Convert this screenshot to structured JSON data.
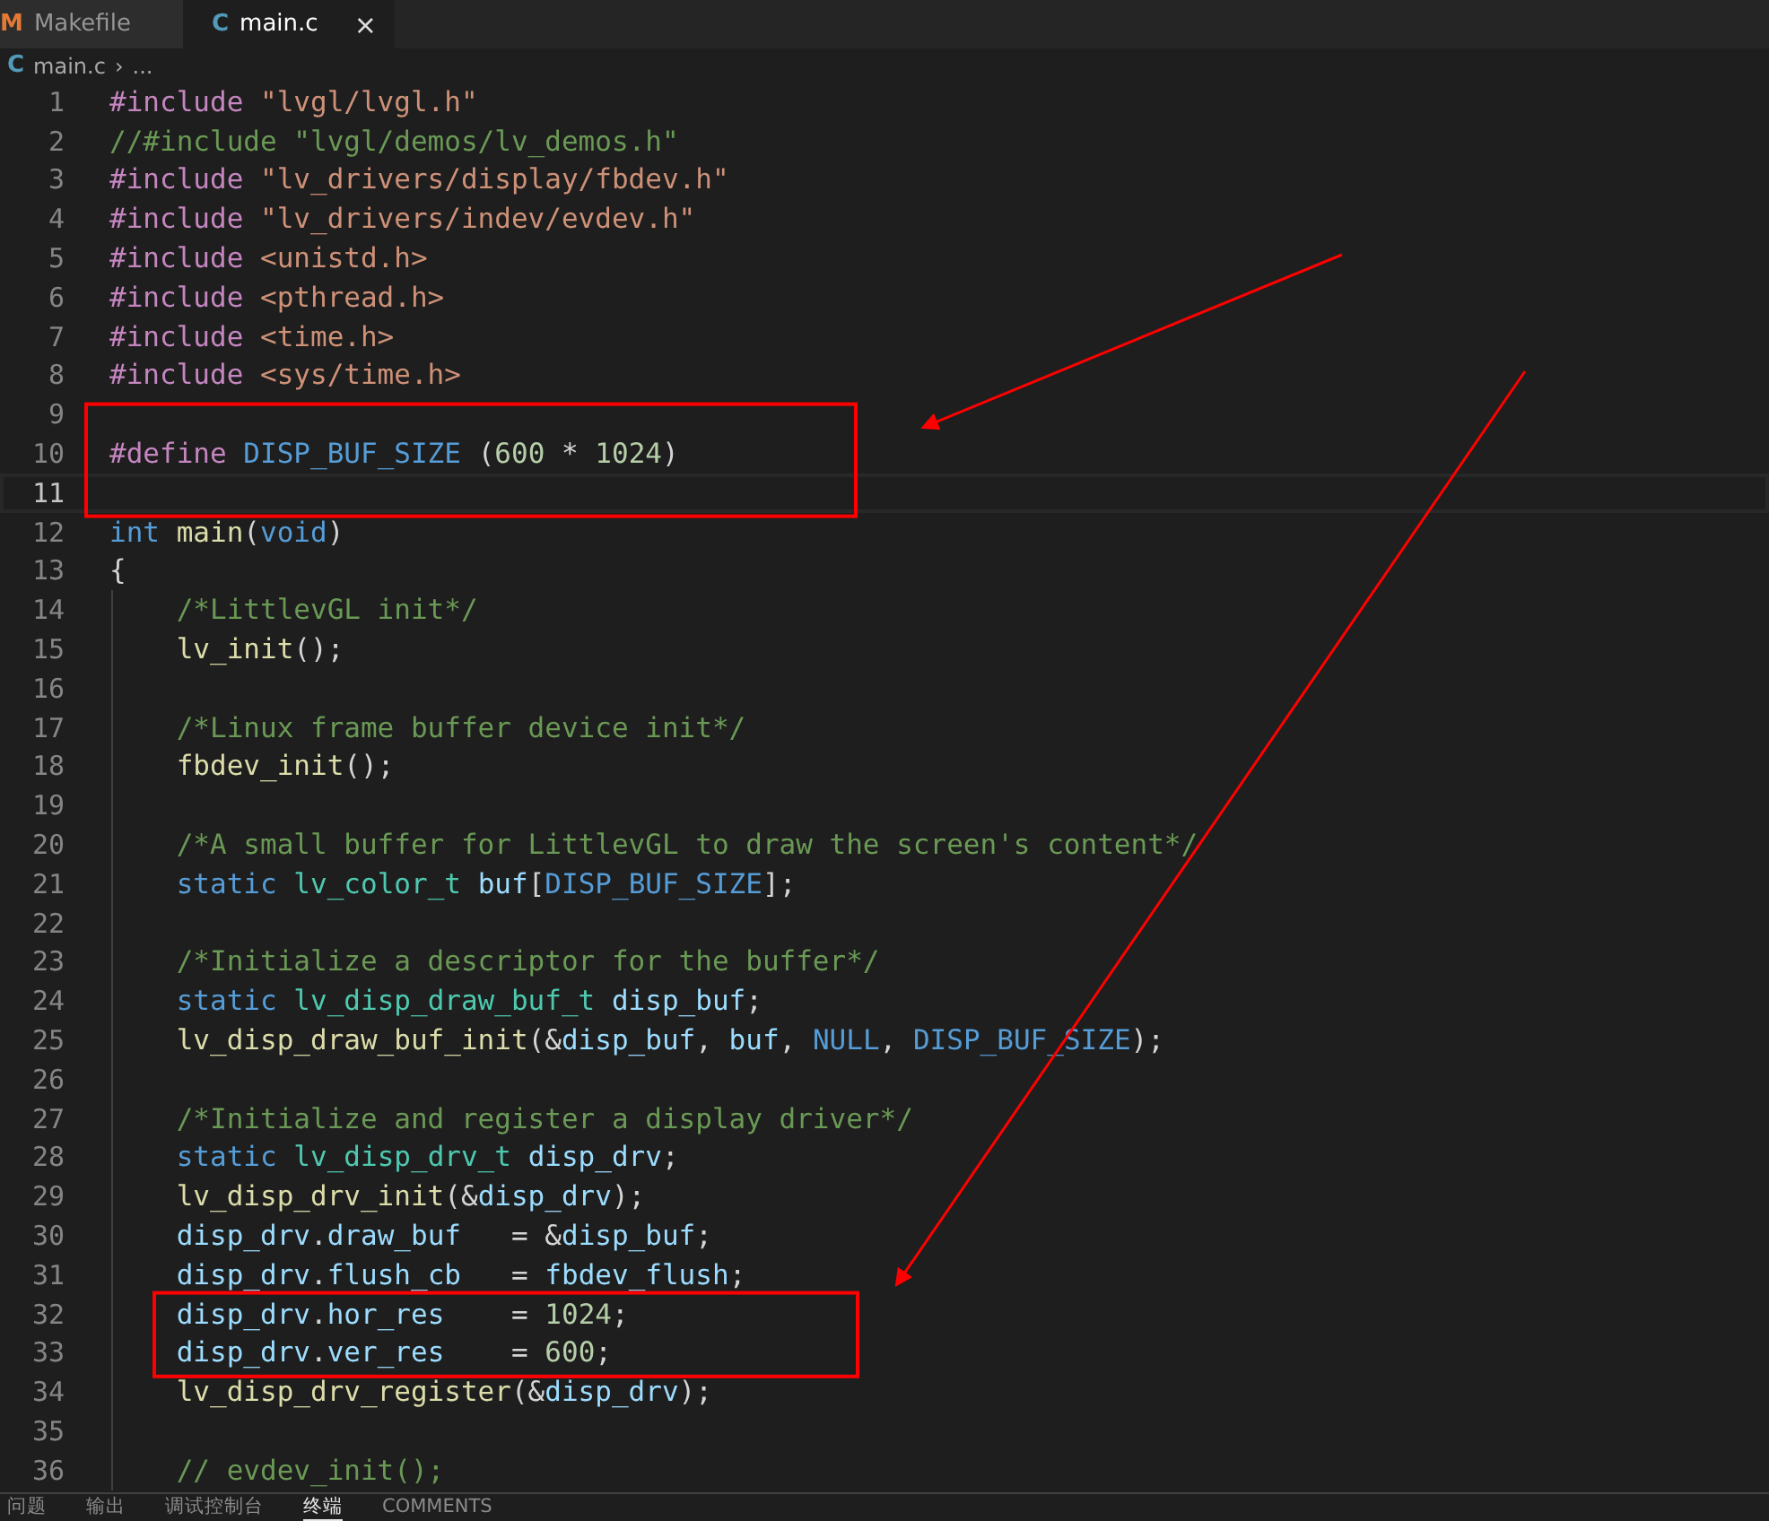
{
  "tabs": [
    {
      "icon": "M",
      "label": "Makefile",
      "selected": false
    },
    {
      "icon": "C",
      "label": "main.c",
      "selected": true,
      "close": "×"
    }
  ],
  "breadcrumb": {
    "icon": "C",
    "items": [
      "main.c",
      "›",
      "..."
    ]
  },
  "code": [
    {
      "n": "1",
      "current": false,
      "tokens": [
        {
          "kind": "pp",
          "text": "#include"
        },
        {
          "kind": "str",
          "text": " \"lvgl/lvgl.h\""
        }
      ]
    },
    {
      "n": "2",
      "current": false,
      "tokens": [
        {
          "kind": "cm",
          "text": "//#include \"lvgl/demos/lv_demos.h\""
        }
      ]
    },
    {
      "n": "3",
      "current": false,
      "tokens": [
        {
          "kind": "pp",
          "text": "#include"
        },
        {
          "kind": "str",
          "text": " \"lv_drivers/display/fbdev.h\""
        }
      ]
    },
    {
      "n": "4",
      "current": false,
      "tokens": [
        {
          "kind": "pp",
          "text": "#include"
        },
        {
          "kind": "str",
          "text": " \"lv_drivers/indev/evdev.h\""
        }
      ]
    },
    {
      "n": "5",
      "current": false,
      "tokens": [
        {
          "kind": "pp",
          "text": "#include"
        },
        {
          "kind": "str",
          "text": " <unistd.h>"
        }
      ]
    },
    {
      "n": "6",
      "current": false,
      "tokens": [
        {
          "kind": "pp",
          "text": "#include"
        },
        {
          "kind": "str",
          "text": " <pthread.h>"
        }
      ]
    },
    {
      "n": "7",
      "current": false,
      "tokens": [
        {
          "kind": "pp",
          "text": "#include"
        },
        {
          "kind": "str",
          "text": " <time.h>"
        }
      ]
    },
    {
      "n": "8",
      "current": false,
      "tokens": [
        {
          "kind": "pp",
          "text": "#include"
        },
        {
          "kind": "str",
          "text": " <sys/time.h>"
        }
      ]
    },
    {
      "n": "9",
      "current": false
    },
    {
      "n": "10",
      "current": false,
      "tokens": [
        {
          "kind": "pp",
          "text": "#define"
        },
        {
          "kind": "mac",
          "text": " DISP_BUF_SIZE"
        },
        {
          "kind": "pl",
          "text": " ("
        },
        {
          "kind": "num",
          "text": "600"
        },
        {
          "kind": "pl",
          "text": " * "
        },
        {
          "kind": "num",
          "text": "1024"
        },
        {
          "kind": "pl",
          "text": ")"
        }
      ]
    },
    {
      "n": "11",
      "current": true
    },
    {
      "n": "12",
      "current": false,
      "tokens": [
        {
          "kind": "kw",
          "text": "int"
        },
        {
          "kind": "fn",
          "text": " main"
        },
        {
          "kind": "pl",
          "text": "("
        },
        {
          "kind": "kw",
          "text": "void"
        },
        {
          "kind": "pl",
          "text": ")"
        }
      ]
    },
    {
      "n": "13",
      "current": false,
      "tokens": [
        {
          "kind": "pl",
          "text": "{"
        }
      ]
    },
    {
      "n": "14",
      "current": false,
      "tokens": [
        {
          "kind": "cm",
          "text": "    /*LittlevGL init*/"
        }
      ]
    },
    {
      "n": "15",
      "current": false,
      "tokens": [
        {
          "kind": "fn",
          "text": "    lv_init"
        },
        {
          "kind": "pl",
          "text": "();"
        }
      ]
    },
    {
      "n": "16",
      "current": false
    },
    {
      "n": "17",
      "current": false,
      "tokens": [
        {
          "kind": "cm",
          "text": "    /*Linux frame buffer device init*/"
        }
      ]
    },
    {
      "n": "18",
      "current": false,
      "tokens": [
        {
          "kind": "fn",
          "text": "    fbdev_init"
        },
        {
          "kind": "pl",
          "text": "();"
        }
      ]
    },
    {
      "n": "19",
      "current": false
    },
    {
      "n": "20",
      "current": false,
      "tokens": [
        {
          "kind": "cm",
          "text": "    /*A small buffer for LittlevGL to draw the screen's content*/"
        }
      ]
    },
    {
      "n": "21",
      "current": false,
      "tokens": [
        {
          "kind": "kw",
          "text": "    static"
        },
        {
          "kind": "type",
          "text": " lv_color_t"
        },
        {
          "kind": "var",
          "text": " buf"
        },
        {
          "kind": "pl",
          "text": "["
        },
        {
          "kind": "mac",
          "text": "DISP_BUF_SIZE"
        },
        {
          "kind": "pl",
          "text": "];"
        }
      ]
    },
    {
      "n": "22",
      "current": false
    },
    {
      "n": "23",
      "current": false,
      "tokens": [
        {
          "kind": "cm",
          "text": "    /*Initialize a descriptor for the buffer*/"
        }
      ]
    },
    {
      "n": "24",
      "current": false,
      "tokens": [
        {
          "kind": "kw",
          "text": "    static"
        },
        {
          "kind": "type",
          "text": " lv_disp_draw_buf_t"
        },
        {
          "kind": "var",
          "text": " disp_buf"
        },
        {
          "kind": "pl",
          "text": ";"
        }
      ]
    },
    {
      "n": "25",
      "current": false,
      "tokens": [
        {
          "kind": "fn",
          "text": "    lv_disp_draw_buf_init"
        },
        {
          "kind": "pl",
          "text": "(&"
        },
        {
          "kind": "var",
          "text": "disp_buf"
        },
        {
          "kind": "pl",
          "text": ", "
        },
        {
          "kind": "var",
          "text": "buf"
        },
        {
          "kind": "pl",
          "text": ", "
        },
        {
          "kind": "kw",
          "text": "NULL"
        },
        {
          "kind": "pl",
          "text": ", "
        },
        {
          "kind": "mac",
          "text": "DISP_BUF_SIZE"
        },
        {
          "kind": "pl",
          "text": ");"
        }
      ]
    },
    {
      "n": "26",
      "current": false
    },
    {
      "n": "27",
      "current": false,
      "tokens": [
        {
          "kind": "cm",
          "text": "    /*Initialize and register a display driver*/"
        }
      ]
    },
    {
      "n": "28",
      "current": false,
      "tokens": [
        {
          "kind": "kw",
          "text": "    static"
        },
        {
          "kind": "type",
          "text": " lv_disp_drv_t"
        },
        {
          "kind": "var",
          "text": " disp_drv"
        },
        {
          "kind": "pl",
          "text": ";"
        }
      ]
    },
    {
      "n": "29",
      "current": false,
      "tokens": [
        {
          "kind": "fn",
          "text": "    lv_disp_drv_init"
        },
        {
          "kind": "pl",
          "text": "(&"
        },
        {
          "kind": "var",
          "text": "disp_drv"
        },
        {
          "kind": "pl",
          "text": ");"
        }
      ]
    },
    {
      "n": "30",
      "current": false,
      "tokens": [
        {
          "kind": "var",
          "text": "    disp_drv"
        },
        {
          "kind": "pl",
          "text": "."
        },
        {
          "kind": "var",
          "text": "draw_buf"
        },
        {
          "kind": "pl",
          "text": "   = &"
        },
        {
          "kind": "var",
          "text": "disp_buf"
        },
        {
          "kind": "pl",
          "text": ";"
        }
      ]
    },
    {
      "n": "31",
      "current": false,
      "tokens": [
        {
          "kind": "var",
          "text": "    disp_drv"
        },
        {
          "kind": "pl",
          "text": "."
        },
        {
          "kind": "var",
          "text": "flush_cb"
        },
        {
          "kind": "pl",
          "text": "   = "
        },
        {
          "kind": "var",
          "text": "fbdev_flush"
        },
        {
          "kind": "pl",
          "text": ";"
        }
      ]
    },
    {
      "n": "32",
      "current": false,
      "tokens": [
        {
          "kind": "var",
          "text": "    disp_drv"
        },
        {
          "kind": "pl",
          "text": "."
        },
        {
          "kind": "var",
          "text": "hor_res"
        },
        {
          "kind": "pl",
          "text": "    = "
        },
        {
          "kind": "num",
          "text": "1024"
        },
        {
          "kind": "pl",
          "text": ";"
        }
      ]
    },
    {
      "n": "33",
      "current": false,
      "tokens": [
        {
          "kind": "var",
          "text": "    disp_drv"
        },
        {
          "kind": "pl",
          "text": "."
        },
        {
          "kind": "var",
          "text": "ver_res"
        },
        {
          "kind": "pl",
          "text": "    = "
        },
        {
          "kind": "num",
          "text": "600"
        },
        {
          "kind": "pl",
          "text": ";"
        }
      ]
    },
    {
      "n": "34",
      "current": false,
      "tokens": [
        {
          "kind": "fn",
          "text": "    lv_disp_drv_register"
        },
        {
          "kind": "pl",
          "text": "(&"
        },
        {
          "kind": "var",
          "text": "disp_drv"
        },
        {
          "kind": "pl",
          "text": ");"
        }
      ]
    },
    {
      "n": "35",
      "current": false
    },
    {
      "n": "36",
      "current": false,
      "tokens": [
        {
          "kind": "cm",
          "text": "    // evdev_init();"
        }
      ]
    }
  ],
  "panel_tabs": [
    {
      "label": "问题",
      "selected": false
    },
    {
      "label": "输出",
      "selected": false
    },
    {
      "label": "调试控制台",
      "selected": false
    },
    {
      "label": "终端",
      "selected": true
    },
    {
      "label": "COMMENTS",
      "selected": false
    }
  ]
}
